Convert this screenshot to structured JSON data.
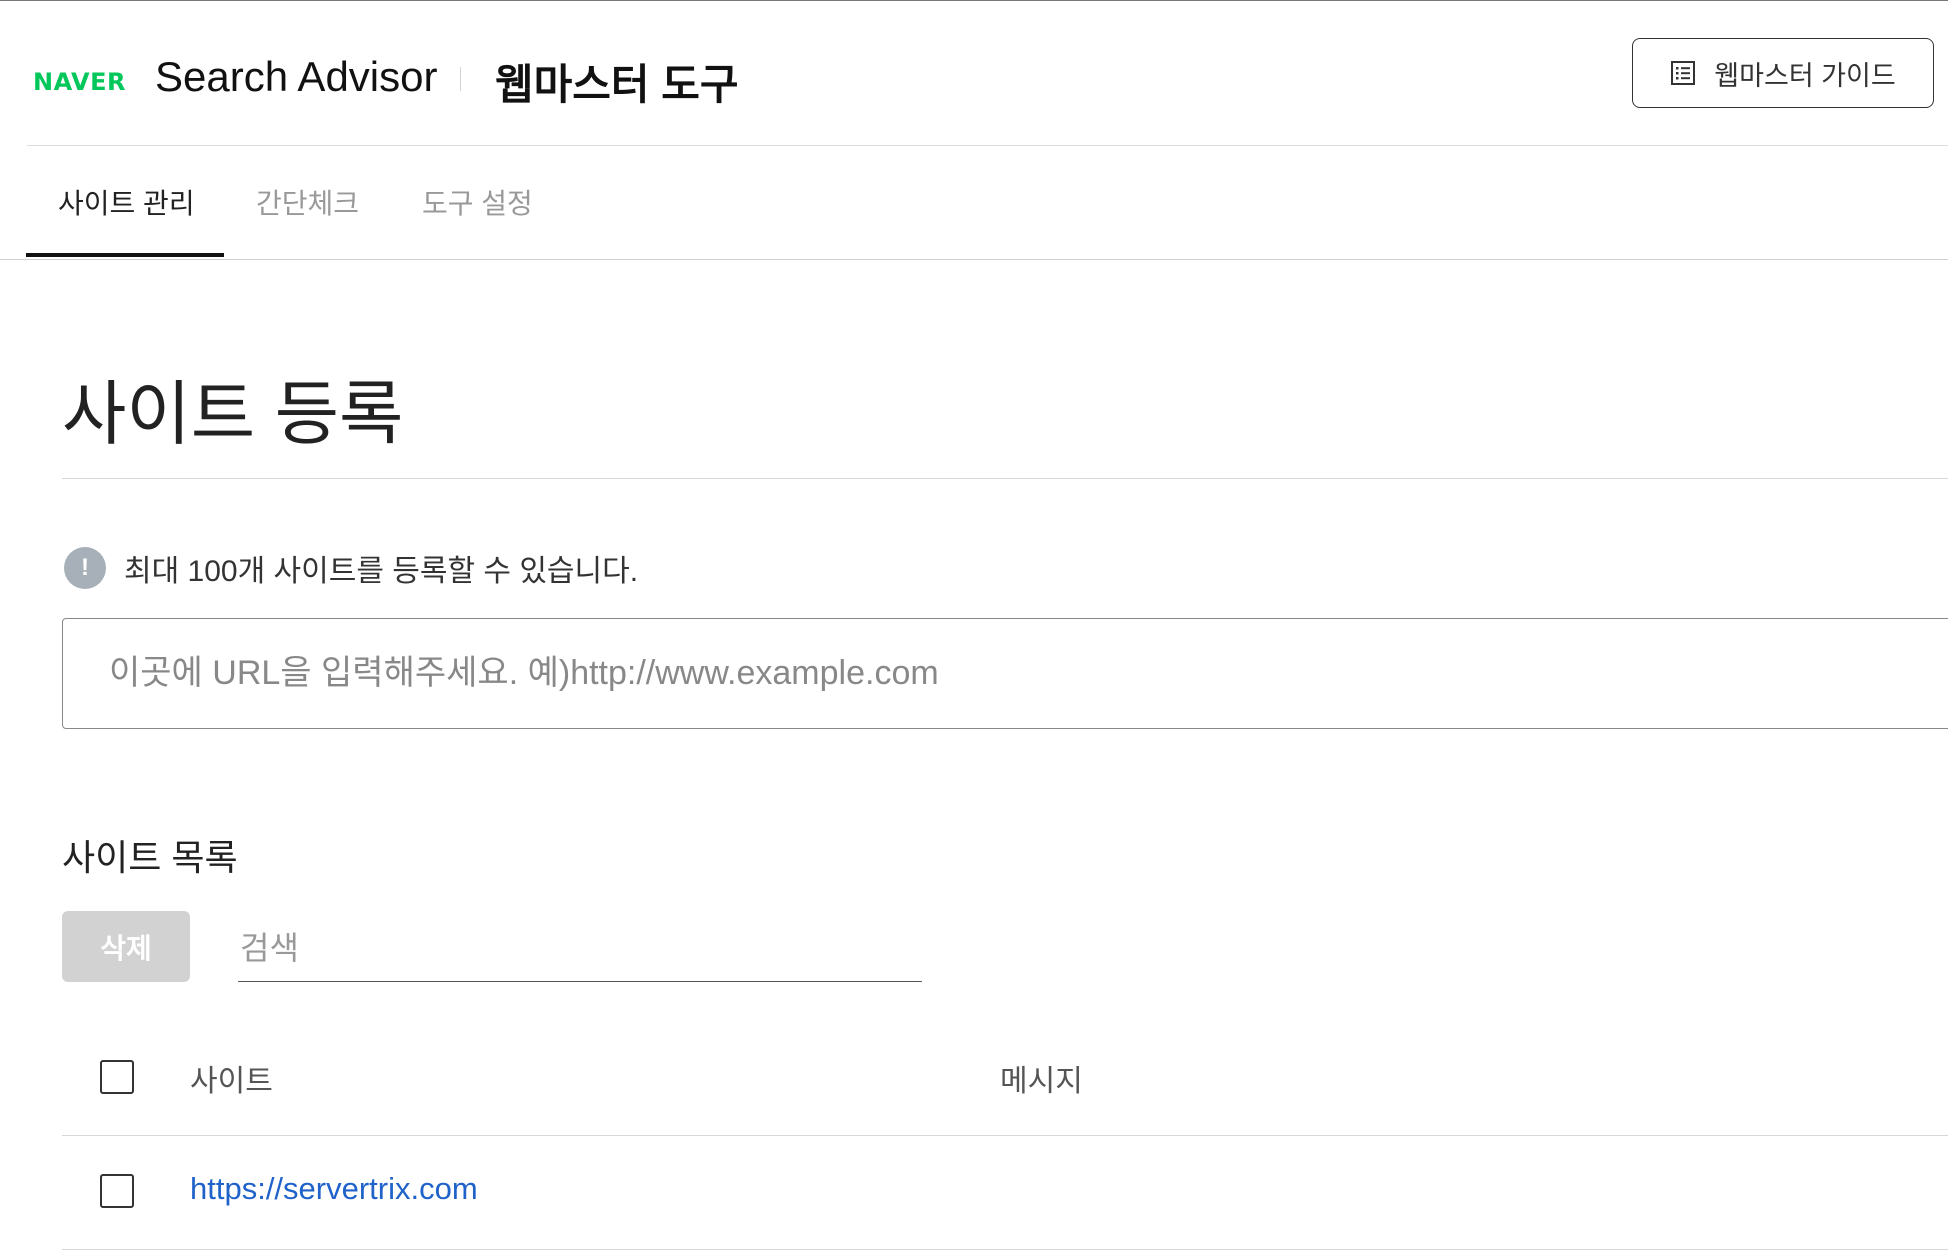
{
  "header": {
    "brand": "NAVER",
    "product": "Search Advisor",
    "subtitle": "웹마스터 도구",
    "guide_button": {
      "label": "웹마스터 가이드",
      "icon": "list-icon"
    }
  },
  "tabs": [
    {
      "label": "사이트 관리",
      "active": true
    },
    {
      "label": "간단체크",
      "active": false
    },
    {
      "label": "도구 설정",
      "active": false
    }
  ],
  "main": {
    "title": "사이트 등록",
    "notice": {
      "icon": "info-icon",
      "glyph": "!",
      "text": "최대 100개 사이트를 등록할 수 있습니다."
    },
    "url_input": {
      "placeholder": "이곳에 URL을 입력해주세요. 예)http://www.example.com",
      "value": ""
    }
  },
  "list": {
    "title": "사이트 목록",
    "delete_label": "삭제",
    "search_placeholder": "검색",
    "columns": {
      "site": "사이트",
      "message": "메시지"
    },
    "rows": [
      {
        "site": "https://servertrix.com",
        "message": ""
      }
    ]
  },
  "colors": {
    "brand": "#03c75a",
    "link": "#1f62c9",
    "disabled_button": "#d2d2d2",
    "info_icon": "#a7b0b8"
  }
}
